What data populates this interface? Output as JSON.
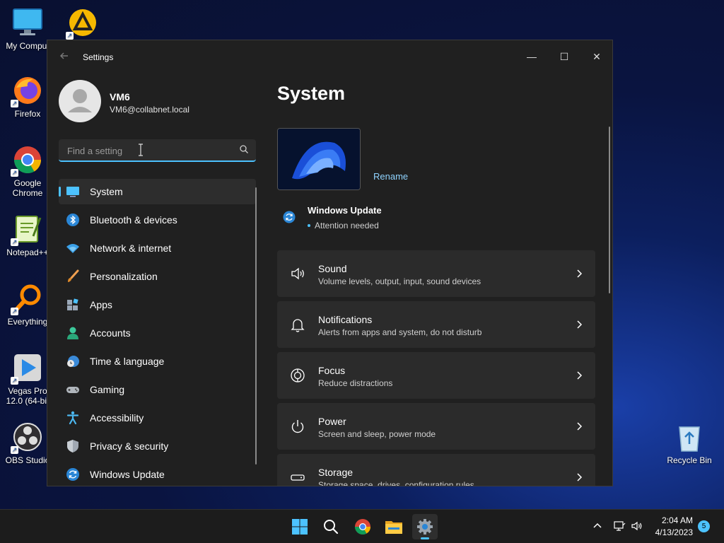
{
  "desktop": {
    "icons": [
      {
        "label": "My Comput",
        "icon": "computer-icon"
      },
      {
        "label": "",
        "icon": "aimp-icon"
      },
      {
        "label": "Firefox",
        "icon": "firefox-icon"
      },
      {
        "label": "Google Chrome",
        "icon": "chrome-icon"
      },
      {
        "label": "Notepad++",
        "icon": "notepadpp-icon"
      },
      {
        "label": "Everything",
        "icon": "everything-icon"
      },
      {
        "label": "Vegas Pro 12.0 (64-bit",
        "icon": "vegas-icon"
      },
      {
        "label": "OBS Studio",
        "icon": "obs-icon"
      },
      {
        "label": "Recycle Bin",
        "icon": "recycle-bin-icon"
      }
    ]
  },
  "window": {
    "title": "Settings",
    "controls": {
      "minimize": "—",
      "maximize": "☐",
      "close": "✕"
    }
  },
  "profile": {
    "name": "VM6",
    "email": "VM6@collabnet.local"
  },
  "search": {
    "placeholder": "Find a setting",
    "value": ""
  },
  "nav": {
    "items": [
      {
        "label": "System",
        "icon": "monitor-icon",
        "active": true
      },
      {
        "label": "Bluetooth & devices",
        "icon": "bluetooth-icon"
      },
      {
        "label": "Network & internet",
        "icon": "wifi-icon"
      },
      {
        "label": "Personalization",
        "icon": "brush-icon"
      },
      {
        "label": "Apps",
        "icon": "apps-icon"
      },
      {
        "label": "Accounts",
        "icon": "person-icon"
      },
      {
        "label": "Time & language",
        "icon": "clock-globe-icon"
      },
      {
        "label": "Gaming",
        "icon": "gamepad-icon"
      },
      {
        "label": "Accessibility",
        "icon": "accessibility-icon"
      },
      {
        "label": "Privacy & security",
        "icon": "shield-icon"
      },
      {
        "label": "Windows Update",
        "icon": "update-icon"
      }
    ]
  },
  "content": {
    "title": "System",
    "rename": "Rename",
    "windows_update": {
      "title": "Windows Update",
      "status": "Attention needed"
    },
    "cards": [
      {
        "title": "Sound",
        "desc": "Volume levels, output, input, sound devices",
        "icon": "speaker-icon"
      },
      {
        "title": "Notifications",
        "desc": "Alerts from apps and system, do not disturb",
        "icon": "bell-icon"
      },
      {
        "title": "Focus",
        "desc": "Reduce distractions",
        "icon": "focus-icon"
      },
      {
        "title": "Power",
        "desc": "Screen and sleep, power mode",
        "icon": "power-icon"
      },
      {
        "title": "Storage",
        "desc": "Storage space, drives, configuration rules",
        "icon": "storage-icon"
      }
    ]
  },
  "taskbar": {
    "apps": [
      "start-icon",
      "search-icon",
      "chrome-icon",
      "file-explorer-icon",
      "settings-icon"
    ],
    "clock_time": "2:04 AM",
    "clock_date": "4/13/2023",
    "notification_count": "5"
  },
  "colors": {
    "accent": "#4cc2ff",
    "window_bg": "#202020",
    "card_bg": "#2b2b2b"
  }
}
